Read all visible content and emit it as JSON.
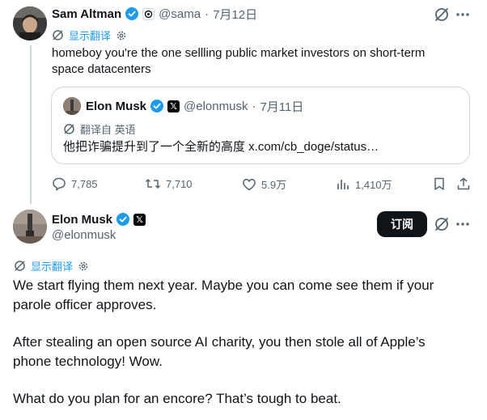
{
  "reply": {
    "author": {
      "name": "Sam Altman",
      "handle": "@sama",
      "date": "7月12日"
    },
    "translate_label": "显示翻译",
    "text_line1": "homeboy you're the one sellling public market investors on short-term",
    "text_line2": "space datacenters",
    "quote": {
      "author": {
        "name": "Elon Musk",
        "handle": "@elonmusk",
        "date": "7月11日"
      },
      "translated_from": "翻译自 英语",
      "text": "他把诈骗提升到了一个全新的高度 x.com/cb_doge/status…"
    },
    "stats": {
      "replies": "7,785",
      "reposts": "7,710",
      "likes": "5.9万",
      "views": "1,410万"
    }
  },
  "main": {
    "author": {
      "name": "Elon Musk",
      "handle": "@elonmusk"
    },
    "subscribe_label": "订阅",
    "translate_label": "显示翻译",
    "paragraph1_line1": "We start flying them next year. Maybe you can come see them if your",
    "paragraph1_line2": "parole officer approves.",
    "paragraph2_line1": "After stealing an open source AI charity, you then stole all of Apple’s",
    "paragraph2_line2": "phone technology! Wow.",
    "paragraph3": "What do you plan for an encore? That’s tough to beat."
  },
  "colors": {
    "accent": "#1d9bf0",
    "text": "#0f1419",
    "muted": "#536471",
    "border": "#cfd9de"
  }
}
